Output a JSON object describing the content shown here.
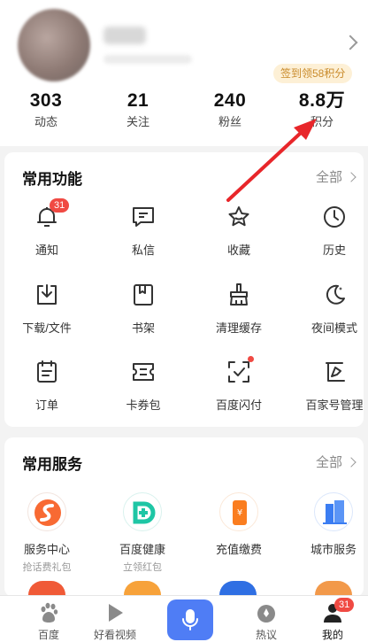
{
  "profile": {
    "signin_badge": "签到领58积分",
    "stats": [
      {
        "value": "303",
        "label": "动态"
      },
      {
        "value": "21",
        "label": "关注"
      },
      {
        "value": "240",
        "label": "粉丝"
      },
      {
        "value": "8.8万",
        "label": "积分"
      }
    ]
  },
  "functions": {
    "title": "常用功能",
    "more": "全部",
    "items": [
      {
        "label": "通知",
        "icon": "bell-icon",
        "badge": "31"
      },
      {
        "label": "私信",
        "icon": "message-icon"
      },
      {
        "label": "收藏",
        "icon": "star-icon"
      },
      {
        "label": "历史",
        "icon": "clock-icon"
      },
      {
        "label": "下载/文件",
        "icon": "download-icon"
      },
      {
        "label": "书架",
        "icon": "bookshelf-icon"
      },
      {
        "label": "清理缓存",
        "icon": "broom-icon"
      },
      {
        "label": "夜间模式",
        "icon": "moon-icon"
      },
      {
        "label": "订单",
        "icon": "order-icon"
      },
      {
        "label": "卡券包",
        "icon": "ticket-icon"
      },
      {
        "label": "百度闪付",
        "icon": "flash-pay-icon"
      },
      {
        "label": "百家号管理",
        "icon": "baijiahao-icon"
      }
    ]
  },
  "services": {
    "title": "常用服务",
    "more": "全部",
    "items": [
      {
        "label": "服务中心",
        "sub": "抢话费礼包",
        "icon": "service-center-icon"
      },
      {
        "label": "百度健康",
        "sub": "立领红包",
        "icon": "health-icon"
      },
      {
        "label": "充值缴费",
        "sub": "",
        "icon": "recharge-icon"
      },
      {
        "label": "城市服务",
        "sub": "",
        "icon": "city-service-icon"
      }
    ]
  },
  "tabbar": {
    "items": [
      {
        "label": "百度",
        "icon": "baidu-paw-icon"
      },
      {
        "label": "好看视频",
        "icon": "play-icon"
      },
      {
        "label": "",
        "icon": "microphone-icon"
      },
      {
        "label": "热议",
        "icon": "hot-topic-icon"
      },
      {
        "label": "我的",
        "icon": "user-icon",
        "badge": "31"
      }
    ]
  },
  "colors": {
    "accent": "#4f7df5",
    "badge": "#f04a43",
    "signin_text": "#c98a2a",
    "arrow": "#e8262a"
  }
}
